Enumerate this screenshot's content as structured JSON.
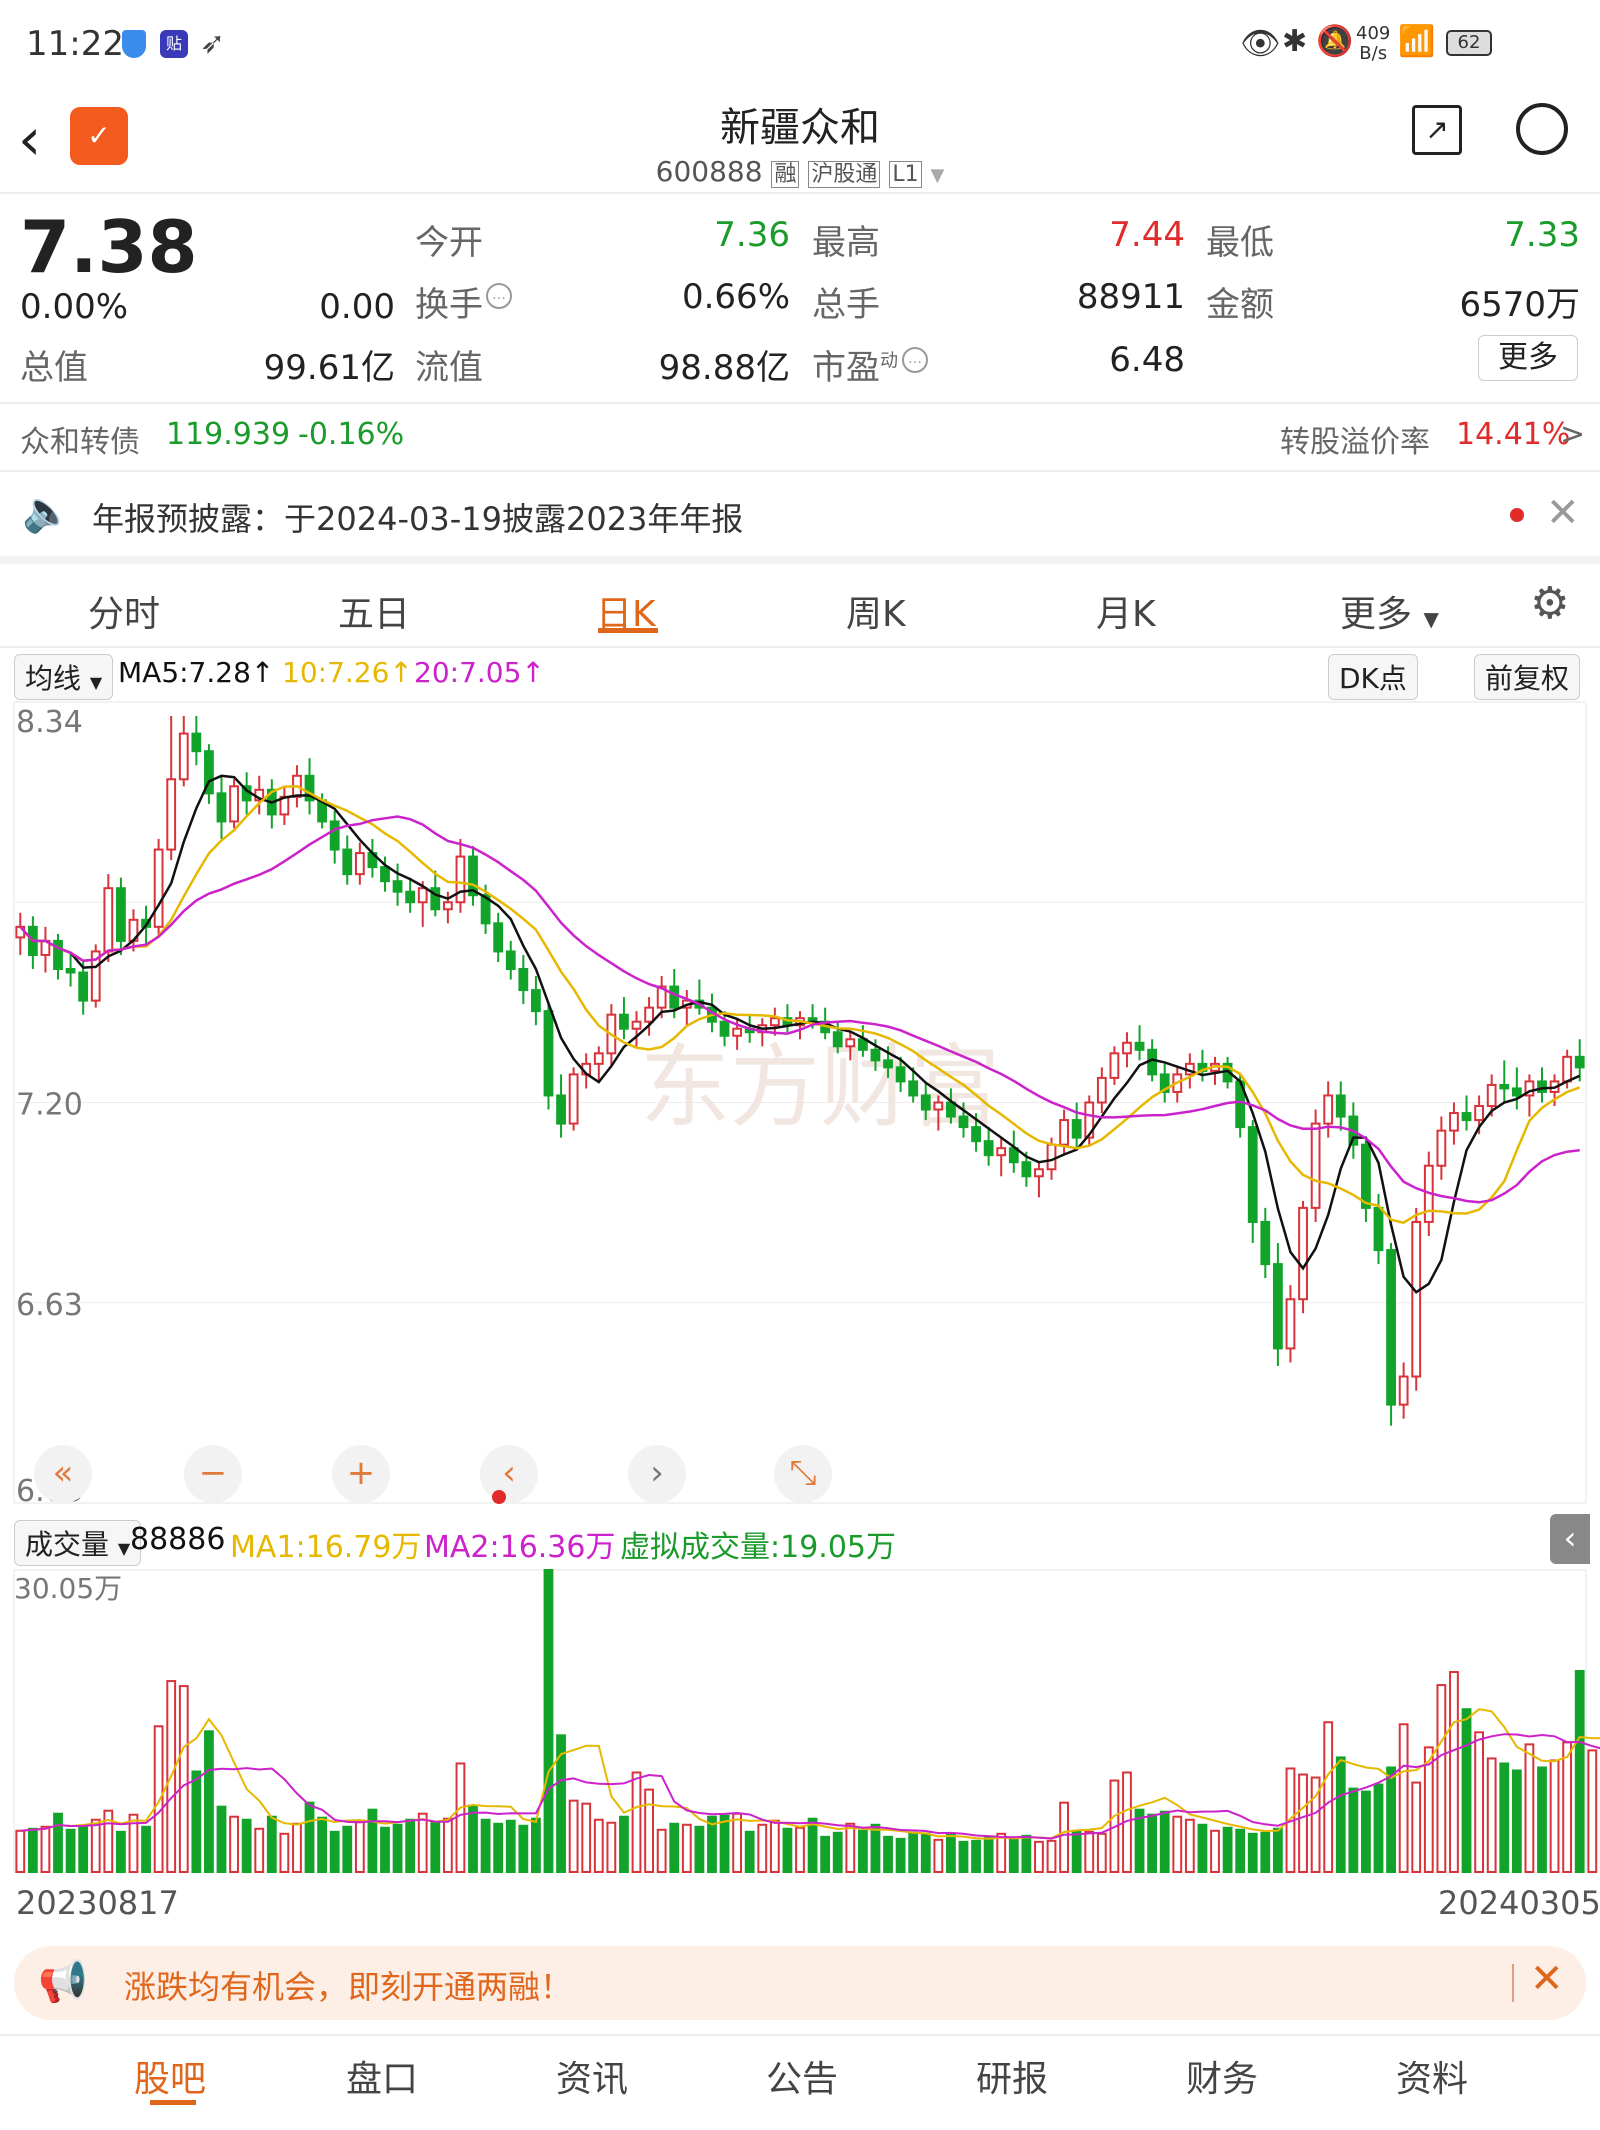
{
  "status": {
    "time": "11:22",
    "net_speed_top": "409",
    "net_speed_bottom": "B/s",
    "battery": "62"
  },
  "header": {
    "title": "新疆众和",
    "code": "600888",
    "badges": [
      "融",
      "沪股通",
      "L1"
    ]
  },
  "quote": {
    "price": "7.38",
    "change_pct": "0.00%",
    "change_amt": "0.00",
    "zongzhi_label": "总值",
    "zongzhi": "99.61亿",
    "jinkai_label": "今开",
    "jinkai": "7.36",
    "huanshou_label": "换手",
    "huanshou": "0.66%",
    "liuzhi_label": "流值",
    "liuzhi": "98.88亿",
    "zuigao_label": "最高",
    "zuigao": "7.44",
    "zongshou_label": "总手",
    "zongshou": "88911",
    "shiying_label": "市盈",
    "shiying_sup": "动",
    "shiying": "6.48",
    "zuidi_label": "最低",
    "zuidi": "7.33",
    "jine_label": "金额",
    "jine": "6570万",
    "more_label": "更多"
  },
  "bond": {
    "name": "众和转债",
    "price": "119.939",
    "change": "-0.16%",
    "premium_label": "转股溢价率",
    "premium": "14.41%",
    "arrow": ">"
  },
  "notice": {
    "text": "年报预披露：于2024-03-19披露2023年年报"
  },
  "tabs": [
    "分时",
    "五日",
    "日K",
    "周K",
    "月K",
    "更多"
  ],
  "ma_bar": {
    "selector": "均线",
    "ma5": "MA5:7.28",
    "ma10": "10:7.26",
    "ma20": "20:7.05",
    "dk_label": "DK点",
    "fq_label": "前复权"
  },
  "vol_bar": {
    "selector": "成交量",
    "vol": "88886",
    "ma1": "MA1:16.79万",
    "ma2": "MA2:16.36万",
    "virtual": "虚拟成交量:19.05万"
  },
  "colors": {
    "up": "#d8333a",
    "down": "#12a42a",
    "ma5": "#111111",
    "ma10": "#e6b800",
    "ma20": "#cc22cc",
    "accent": "#e0661b"
  },
  "watermark": "东方财富",
  "banner": {
    "text": "涨跌均有机会，即刻开通两融！"
  },
  "bottom_nav": [
    "股吧",
    "盘口",
    "资讯",
    "公告",
    "研报",
    "财务",
    "资料"
  ],
  "chart_data": {
    "type": "candlestick",
    "x_start": "20230817",
    "x_end": "20240305",
    "price_axis": [
      "8.34",
      "7.20",
      "6.63",
      "6.06"
    ],
    "price_range": [
      6.06,
      8.34
    ],
    "volume_axis_max": "30.05万",
    "volume_range": [
      0,
      30.05
    ],
    "candles": [
      [
        7.67,
        7.74,
        7.62,
        7.7
      ],
      [
        7.7,
        7.73,
        7.58,
        7.62
      ],
      [
        7.62,
        7.7,
        7.57,
        7.66
      ],
      [
        7.66,
        7.68,
        7.55,
        7.58
      ],
      [
        7.58,
        7.63,
        7.53,
        7.57
      ],
      [
        7.57,
        7.6,
        7.45,
        7.49
      ],
      [
        7.49,
        7.65,
        7.47,
        7.63
      ],
      [
        7.63,
        7.85,
        7.6,
        7.81
      ],
      [
        7.81,
        7.84,
        7.62,
        7.66
      ],
      [
        7.66,
        7.75,
        7.63,
        7.72
      ],
      [
        7.72,
        7.76,
        7.65,
        7.7
      ],
      [
        7.7,
        7.95,
        7.67,
        7.92
      ],
      [
        7.92,
        8.3,
        7.89,
        8.12
      ],
      [
        8.12,
        8.3,
        8.1,
        8.25
      ],
      [
        8.25,
        8.3,
        8.16,
        8.2
      ],
      [
        8.2,
        8.22,
        8.05,
        8.08
      ],
      [
        8.08,
        8.13,
        7.95,
        8.0
      ],
      [
        8.0,
        8.12,
        7.98,
        8.1
      ],
      [
        8.1,
        8.14,
        8.02,
        8.06
      ],
      [
        8.06,
        8.13,
        8.02,
        8.09
      ],
      [
        8.09,
        8.12,
        7.98,
        8.02
      ],
      [
        8.02,
        8.1,
        7.99,
        8.07
      ],
      [
        8.07,
        8.16,
        8.04,
        8.13
      ],
      [
        8.13,
        8.18,
        8.02,
        8.06
      ],
      [
        8.06,
        8.08,
        7.98,
        8.0
      ],
      [
        8.0,
        8.03,
        7.88,
        7.92
      ],
      [
        7.92,
        7.96,
        7.82,
        7.85
      ],
      [
        7.85,
        7.94,
        7.82,
        7.91
      ],
      [
        7.91,
        7.95,
        7.84,
        7.87
      ],
      [
        7.87,
        7.9,
        7.8,
        7.83
      ],
      [
        7.83,
        7.88,
        7.76,
        7.8
      ],
      [
        7.8,
        7.84,
        7.74,
        7.77
      ],
      [
        7.77,
        7.83,
        7.7,
        7.81
      ],
      [
        7.81,
        7.86,
        7.73,
        7.75
      ],
      [
        7.75,
        7.8,
        7.71,
        7.77
      ],
      [
        7.77,
        7.95,
        7.74,
        7.9
      ],
      [
        7.9,
        7.93,
        7.76,
        7.79
      ],
      [
        7.79,
        7.82,
        7.68,
        7.71
      ],
      [
        7.71,
        7.74,
        7.6,
        7.63
      ],
      [
        7.63,
        7.66,
        7.55,
        7.58
      ],
      [
        7.58,
        7.62,
        7.48,
        7.52
      ],
      [
        7.52,
        7.56,
        7.42,
        7.46
      ],
      [
        7.46,
        7.48,
        7.18,
        7.22
      ],
      [
        7.22,
        7.28,
        7.1,
        7.14
      ],
      [
        7.14,
        7.3,
        7.12,
        7.28
      ],
      [
        7.28,
        7.34,
        7.24,
        7.31
      ],
      [
        7.31,
        7.36,
        7.26,
        7.34
      ],
      [
        7.34,
        7.48,
        7.3,
        7.45
      ],
      [
        7.45,
        7.5,
        7.38,
        7.41
      ],
      [
        7.41,
        7.46,
        7.36,
        7.43
      ],
      [
        7.43,
        7.5,
        7.39,
        7.47
      ],
      [
        7.47,
        7.56,
        7.44,
        7.53
      ],
      [
        7.53,
        7.58,
        7.44,
        7.47
      ],
      [
        7.47,
        7.52,
        7.42,
        7.49
      ],
      [
        7.49,
        7.55,
        7.45,
        7.47
      ],
      [
        7.47,
        7.51,
        7.4,
        7.43
      ],
      [
        7.43,
        7.46,
        7.36,
        7.39
      ],
      [
        7.39,
        7.44,
        7.35,
        7.41
      ],
      [
        7.41,
        7.45,
        7.37,
        7.4
      ],
      [
        7.4,
        7.44,
        7.36,
        7.42
      ],
      [
        7.42,
        7.47,
        7.39,
        7.44
      ],
      [
        7.44,
        7.48,
        7.4,
        7.42
      ],
      [
        7.42,
        7.46,
        7.38,
        7.44
      ],
      [
        7.44,
        7.48,
        7.41,
        7.43
      ],
      [
        7.43,
        7.47,
        7.38,
        7.4
      ],
      [
        7.4,
        7.43,
        7.34,
        7.36
      ],
      [
        7.36,
        7.4,
        7.32,
        7.38
      ],
      [
        7.38,
        7.42,
        7.33,
        7.35
      ],
      [
        7.35,
        7.38,
        7.29,
        7.32
      ],
      [
        7.32,
        7.36,
        7.27,
        7.3
      ],
      [
        7.3,
        7.33,
        7.23,
        7.26
      ],
      [
        7.26,
        7.3,
        7.2,
        7.22
      ],
      [
        7.22,
        7.26,
        7.15,
        7.18
      ],
      [
        7.18,
        7.22,
        7.12,
        7.2
      ],
      [
        7.2,
        7.24,
        7.14,
        7.16
      ],
      [
        7.16,
        7.2,
        7.1,
        7.13
      ],
      [
        7.13,
        7.17,
        7.06,
        7.09
      ],
      [
        7.09,
        7.13,
        7.02,
        7.05
      ],
      [
        7.05,
        7.1,
        6.99,
        7.07
      ],
      [
        7.07,
        7.12,
        7.0,
        7.03
      ],
      [
        7.03,
        7.06,
        6.96,
        6.99
      ],
      [
        6.99,
        7.03,
        6.93,
        7.01
      ],
      [
        7.01,
        7.1,
        6.98,
        7.08
      ],
      [
        7.08,
        7.18,
        7.05,
        7.15
      ],
      [
        7.15,
        7.2,
        7.07,
        7.1
      ],
      [
        7.1,
        7.22,
        7.08,
        7.2
      ],
      [
        7.2,
        7.3,
        7.17,
        7.27
      ],
      [
        7.27,
        7.36,
        7.25,
        7.34
      ],
      [
        7.34,
        7.4,
        7.3,
        7.37
      ],
      [
        7.37,
        7.42,
        7.32,
        7.35
      ],
      [
        7.35,
        7.38,
        7.26,
        7.28
      ],
      [
        7.28,
        7.31,
        7.2,
        7.23
      ],
      [
        7.23,
        7.3,
        7.2,
        7.28
      ],
      [
        7.28,
        7.34,
        7.24,
        7.31
      ],
      [
        7.31,
        7.35,
        7.26,
        7.29
      ],
      [
        7.29,
        7.33,
        7.25,
        7.31
      ],
      [
        7.31,
        7.33,
        7.24,
        7.26
      ],
      [
        7.26,
        7.28,
        7.1,
        7.13
      ],
      [
        7.13,
        7.15,
        6.8,
        6.86
      ],
      [
        6.86,
        6.9,
        6.7,
        6.74
      ],
      [
        6.74,
        6.8,
        6.45,
        6.5
      ],
      [
        6.5,
        6.68,
        6.46,
        6.64
      ],
      [
        6.64,
        6.92,
        6.6,
        6.9
      ],
      [
        6.9,
        7.18,
        6.86,
        7.14
      ],
      [
        7.14,
        7.26,
        7.1,
        7.22
      ],
      [
        7.22,
        7.26,
        7.12,
        7.16
      ],
      [
        7.16,
        7.2,
        7.04,
        7.08
      ],
      [
        7.08,
        7.1,
        6.86,
        6.9
      ],
      [
        6.9,
        6.94,
        6.74,
        6.78
      ],
      [
        6.78,
        6.8,
        6.28,
        6.34
      ],
      [
        6.34,
        6.46,
        6.3,
        6.42
      ],
      [
        6.42,
        6.9,
        6.38,
        6.86
      ],
      [
        6.86,
        7.06,
        6.82,
        7.02
      ],
      [
        7.02,
        7.16,
        6.98,
        7.12
      ],
      [
        7.12,
        7.2,
        7.08,
        7.17
      ],
      [
        7.17,
        7.22,
        7.12,
        7.15
      ],
      [
        7.15,
        7.22,
        7.11,
        7.19
      ],
      [
        7.19,
        7.28,
        7.16,
        7.25
      ],
      [
        7.25,
        7.32,
        7.2,
        7.24
      ],
      [
        7.24,
        7.3,
        7.18,
        7.22
      ],
      [
        7.22,
        7.28,
        7.16,
        7.26
      ],
      [
        7.26,
        7.3,
        7.2,
        7.23
      ],
      [
        7.23,
        7.28,
        7.19,
        7.26
      ],
      [
        7.26,
        7.35,
        7.24,
        7.33
      ],
      [
        7.33,
        7.38,
        7.26,
        7.3
      ]
    ],
    "volumes": [
      4.1,
      4.3,
      4.5,
      5.8,
      4.2,
      4.6,
      5.2,
      6.1,
      4.0,
      5.7,
      4.5,
      14.5,
      19.0,
      18.5,
      10.0,
      14.0,
      6.5,
      5.5,
      5.2,
      4.3,
      5.5,
      3.8,
      4.8,
      6.9,
      5.4,
      4.0,
      4.5,
      5.0,
      6.2,
      4.4,
      4.7,
      5.2,
      5.8,
      4.9,
      5.3,
      10.8,
      6.6,
      5.2,
      4.8,
      5.1,
      4.6,
      5.3,
      30.05,
      13.6,
      7.1,
      6.8,
      5.2,
      4.9,
      5.5,
      9.9,
      8.2,
      4.2,
      4.8,
      4.7,
      4.5,
      5.5,
      5.6,
      5.8,
      4.0,
      4.7,
      5.1,
      4.3,
      4.4,
      5.3,
      3.5,
      3.9,
      4.8,
      4.1,
      4.7,
      3.5,
      3.3,
      3.9,
      3.8,
      3.2,
      3.7,
      3.0,
      3.1,
      3.5,
      3.8,
      3.3,
      3.6,
      3.0,
      3.1,
      6.9,
      4.1,
      4.0,
      3.8,
      9.1,
      9.9,
      6.2,
      5.7,
      6.0,
      5.5,
      5.2,
      4.7,
      4.1,
      4.4,
      4.2,
      3.8,
      3.9,
      4.3,
      10.3,
      9.7,
      9.4,
      14.9,
      11.4,
      8.3,
      8.0,
      8.7,
      10.4,
      14.7,
      8.9,
      12.4,
      18.6,
      19.9,
      16.2,
      13.9,
      11.3,
      10.8,
      10.1,
      12.7,
      10.4,
      11.1,
      12.9,
      20.0,
      12.1,
      10.5,
      25.4,
      7.3
    ],
    "ma5_final": 7.28,
    "ma10_final": 7.26,
    "ma20_final": 7.05,
    "vol_ma1_final": 16.79,
    "vol_ma2_final": 16.36
  }
}
